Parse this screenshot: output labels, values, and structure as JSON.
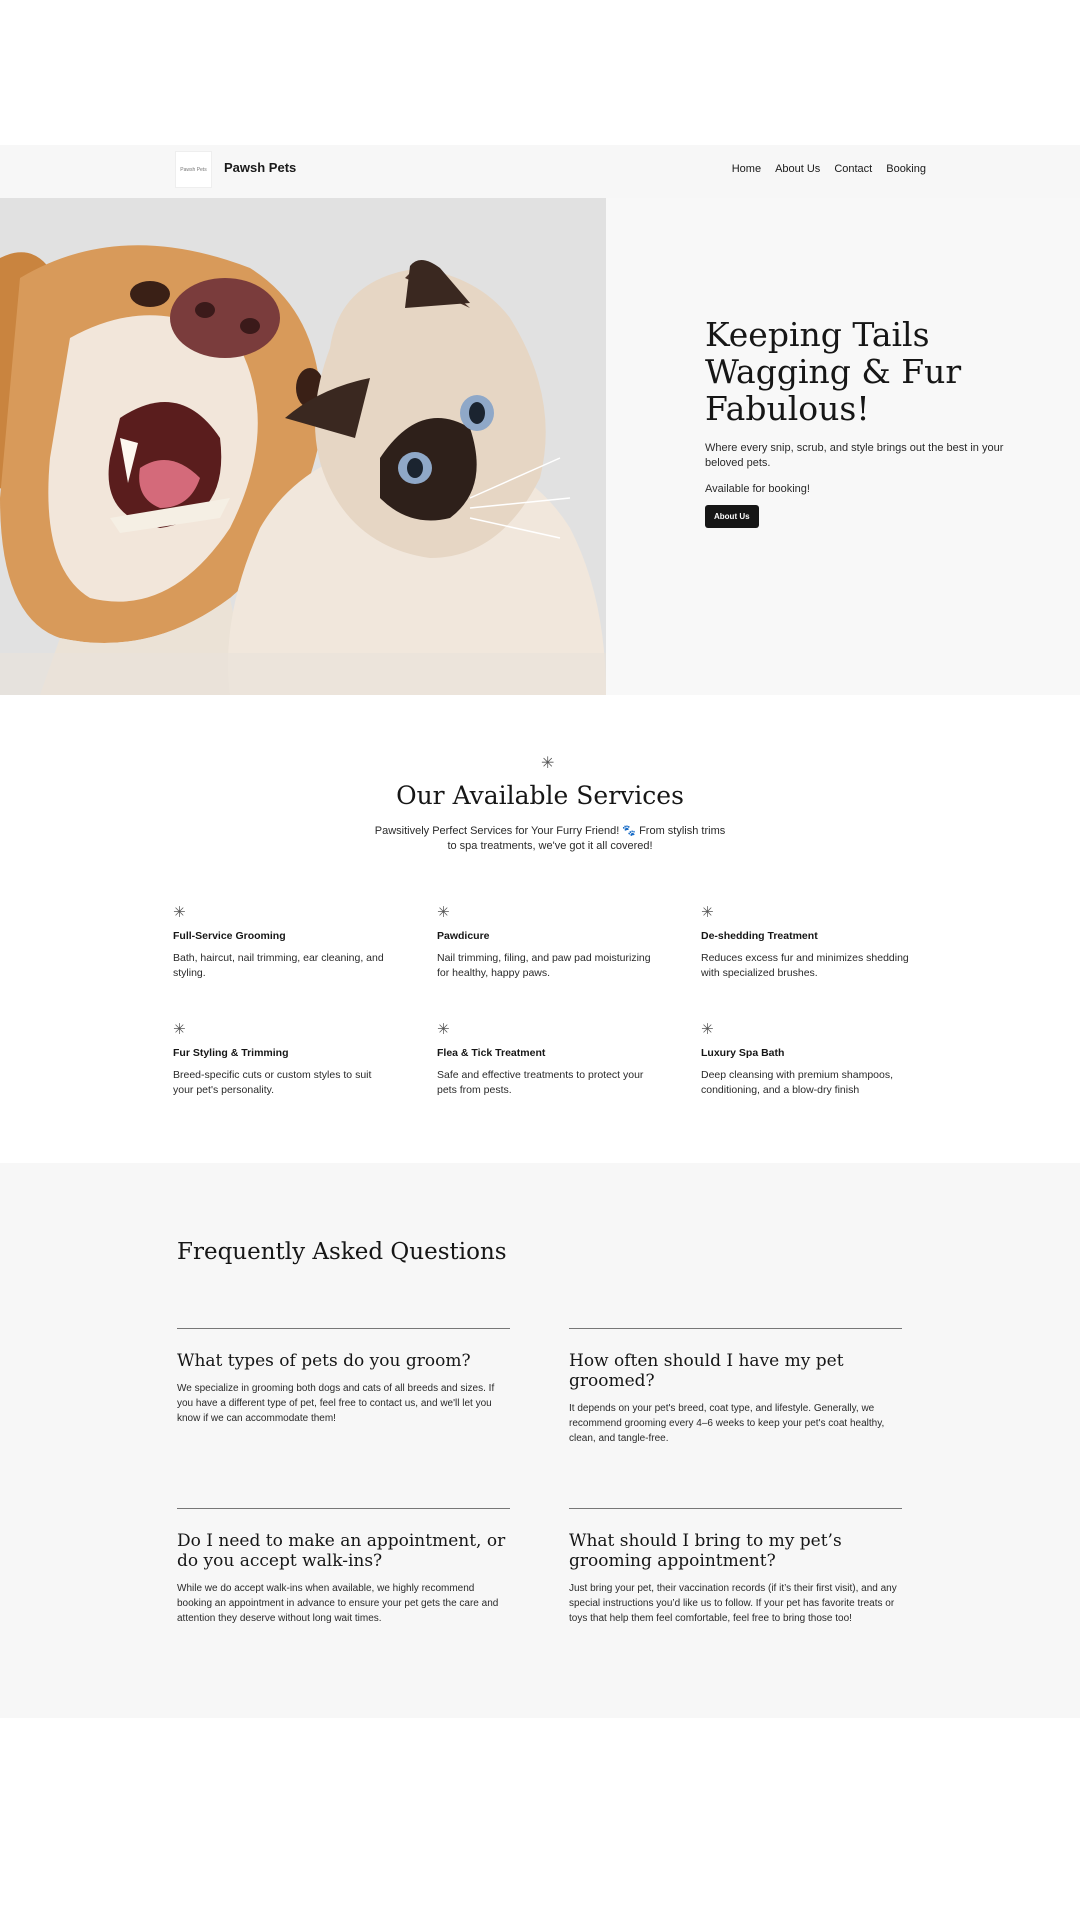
{
  "header": {
    "logo_text": "Pawsh Pets",
    "brand": "Pawsh Pets",
    "nav": [
      "Home",
      "About Us",
      "Contact",
      "Booking"
    ]
  },
  "hero": {
    "title": "Keeping Tails Wagging & Fur Fabulous!",
    "subtitle": "Where every snip, scrub, and style brings out the best in your beloved pets.",
    "booking_note": "Available for booking!",
    "button": "About Us"
  },
  "services": {
    "title": "Our Available Services",
    "subtitle": "Pawsitively Perfect Services for Your Furry Friend! 🐾 From stylish trims to spa treatments, we've got it all covered!",
    "items": [
      {
        "name": "Full-Service Grooming",
        "desc": "Bath, haircut, nail trimming, ear cleaning, and styling."
      },
      {
        "name": "Pawdicure",
        "desc": "Nail trimming, filing, and paw pad moisturizing for healthy, happy paws."
      },
      {
        "name": "De-shedding Treatment",
        "desc": "Reduces excess fur and minimizes shedding with specialized brushes."
      },
      {
        "name": "Fur Styling & Trimming",
        "desc": "Breed-specific cuts or custom styles to suit your pet's personality."
      },
      {
        "name": "Flea & Tick Treatment",
        "desc": "Safe and effective treatments to protect your pets from pests."
      },
      {
        "name": "Luxury Spa Bath",
        "desc": "Deep cleansing with premium shampoos, conditioning, and a blow-dry finish"
      }
    ]
  },
  "faq": {
    "title": "Frequently Asked Questions",
    "items": [
      {
        "q": "What types of pets do you groom?",
        "a": "We specialize in grooming both dogs and cats of all breeds and sizes. If you have a different type of pet, feel free to contact us, and we'll let you know if we can accommodate them!"
      },
      {
        "q": "How often should I have my pet groomed?",
        "a": "It depends on your pet's breed, coat type, and lifestyle. Generally, we recommend grooming every 4–6 weeks to keep your pet's coat healthy, clean, and tangle-free."
      },
      {
        "q": "Do I need to make an appointment, or do you accept walk-ins?",
        "a": "While we do accept walk-ins when available, we highly recommend booking an appointment in advance to ensure your pet gets the care and attention they deserve without long wait times."
      },
      {
        "q": "What should I bring to my pet’s grooming appointment?",
        "a": "Just bring your pet, their vaccination records (if it’s their first visit), and any special instructions you’d like us to follow. If your pet has favorite treats or toys that help them feel comfortable, feel free to bring those too!"
      }
    ]
  }
}
